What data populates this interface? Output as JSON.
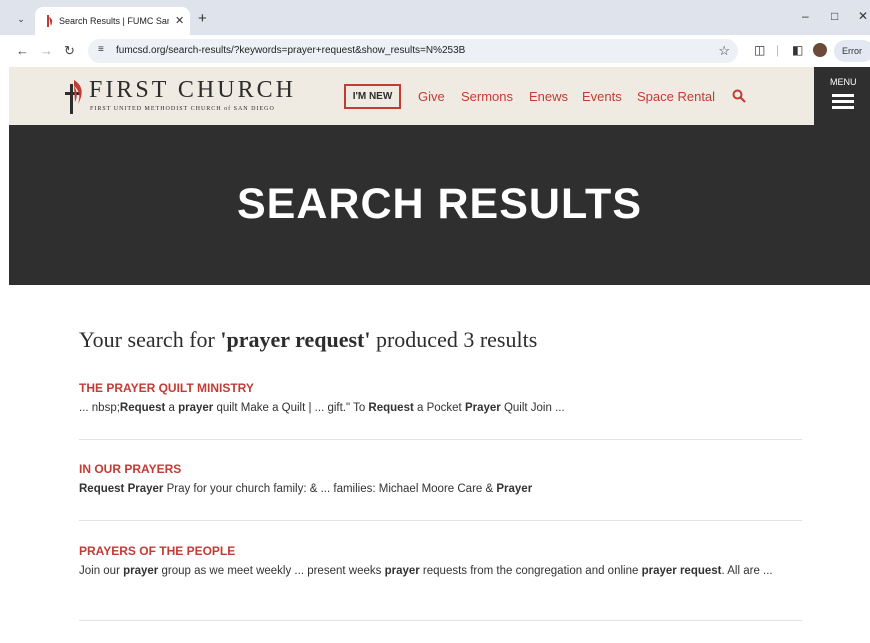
{
  "browser": {
    "tab_title": "Search Results | FUMC San Diego",
    "url": "fumcsd.org/search-results/?keywords=prayer+request&show_results=N%253B",
    "profile_button": "Error"
  },
  "header": {
    "logo_title": "FIRST CHURCH",
    "logo_subtitle": "FIRST UNITED METHODIST CHURCH of SAN DIEGO",
    "im_new": "I'M NEW",
    "nav": [
      "Give",
      "Sermons",
      "Enews",
      "Events",
      "Space Rental"
    ],
    "menu_label": "MENU",
    "accent_color": "#c23b34"
  },
  "hero": {
    "title": "SEARCH RESULTS"
  },
  "search": {
    "prefix": "Your search for",
    "query": "'prayer request'",
    "suffix": "produced 3 results"
  },
  "results": [
    {
      "title": "THE PRAYER QUILT MINISTRY",
      "snippet": [
        {
          "t": "... nbsp;",
          "b": false
        },
        {
          "t": "Request",
          "b": true
        },
        {
          "t": " a ",
          "b": false
        },
        {
          "t": "prayer",
          "b": true
        },
        {
          "t": " quilt  Make a Quilt | ... gift.\"  To ",
          "b": false
        },
        {
          "t": "Request",
          "b": true
        },
        {
          "t": " a Pocket ",
          "b": false
        },
        {
          "t": "Prayer",
          "b": true
        },
        {
          "t": " Quilt    Join ...",
          "b": false
        }
      ]
    },
    {
      "title": "IN OUR PRAYERS",
      "snippet": [
        {
          "t": "Request",
          "b": true
        },
        {
          "t": " ",
          "b": false
        },
        {
          "t": "Prayer",
          "b": true
        },
        {
          "t": " Pray for your church family: & ... families: Michael Moore Care & ",
          "b": false
        },
        {
          "t": "Prayer",
          "b": true
        }
      ]
    },
    {
      "title": "PRAYERS OF THE PEOPLE",
      "snippet": [
        {
          "t": "Join our ",
          "b": false
        },
        {
          "t": "prayer",
          "b": true
        },
        {
          "t": " group as we meet weekly ... present weeks ",
          "b": false
        },
        {
          "t": "prayer",
          "b": true
        },
        {
          "t": " requests from the congregation and online ",
          "b": false
        },
        {
          "t": "prayer",
          "b": true
        },
        {
          "t": " ",
          "b": false
        },
        {
          "t": "request",
          "b": true
        },
        {
          "t": ". All are ...",
          "b": false
        }
      ]
    }
  ]
}
